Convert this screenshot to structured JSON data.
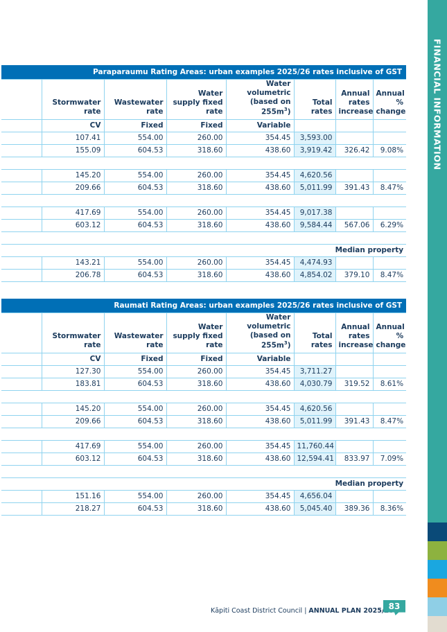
{
  "side_tab": {
    "label": "FINANCIAL INFORMATION"
  },
  "strip_colors": [
    "#0a4a78",
    "#8db23f",
    "#1aa7e0",
    "#f08c1e",
    "#8fcfe6",
    "#e2dcd0"
  ],
  "tables": [
    {
      "title": "Paraparaumu Rating Areas: urban examples 2025/26 rates inclusive of GST",
      "headers": {
        "stormwater": "Stormwater rate",
        "wastewater": "Wastewater rate",
        "water_fixed": "Water supply fixed rate",
        "water_vol_a": "Water volumetric",
        "water_vol_b": "(based on 255m",
        "water_vol_sup": "3",
        "water_vol_c": ")",
        "total": "Total rates",
        "annual_inc": "Annual rates increase",
        "annual_pct": "Annual % change"
      },
      "basis": {
        "stormwater": "CV",
        "wastewater": "Fixed",
        "water_fixed": "Fixed",
        "water_vol": "Variable"
      },
      "groups": [
        {
          "rows": [
            [
              "107.41",
              "554.00",
              "260.00",
              "354.45",
              "3,593.00",
              "",
              ""
            ],
            [
              "155.09",
              "604.53",
              "318.60",
              "438.60",
              "3,919.42",
              "326.42",
              "9.08%"
            ]
          ]
        },
        {
          "rows": [
            [
              "145.20",
              "554.00",
              "260.00",
              "354.45",
              "4,620.56",
              "",
              ""
            ],
            [
              "209.66",
              "604.53",
              "318.60",
              "438.60",
              "5,011.99",
              "391.43",
              "8.47%"
            ]
          ]
        },
        {
          "rows": [
            [
              "417.69",
              "554.00",
              "260.00",
              "354.45",
              "9,017.38",
              "",
              ""
            ],
            [
              "603.12",
              "604.53",
              "318.60",
              "438.60",
              "9,584.44",
              "567.06",
              "6.29%"
            ]
          ]
        }
      ],
      "median_label": "Median property",
      "median_rows": [
        [
          "143.21",
          "554.00",
          "260.00",
          "354.45",
          "4,474.93",
          "",
          ""
        ],
        [
          "206.78",
          "604.53",
          "318.60",
          "438.60",
          "4,854.02",
          "379.10",
          "8.47%"
        ]
      ]
    },
    {
      "title": "Raumati Rating Areas: urban examples 2025/26 rates inclusive of GST",
      "headers": {
        "stormwater": "Stormwater rate",
        "wastewater": "Wastewater rate",
        "water_fixed": "Water supply fixed rate",
        "water_vol_a": "Water volumetric",
        "water_vol_b": "(based on 255m",
        "water_vol_sup": "3",
        "water_vol_c": ")",
        "total": "Total rates",
        "annual_inc": "Annual rates increase",
        "annual_pct": "Annual % change"
      },
      "basis": {
        "stormwater": "CV",
        "wastewater": "Fixed",
        "water_fixed": "Fixed",
        "water_vol": "Variable"
      },
      "groups": [
        {
          "rows": [
            [
              "127.30",
              "554.00",
              "260.00",
              "354.45",
              "3,711.27",
              "",
              ""
            ],
            [
              "183.81",
              "604.53",
              "318.60",
              "438.60",
              "4,030.79",
              "319.52",
              "8.61%"
            ]
          ]
        },
        {
          "rows": [
            [
              "145.20",
              "554.00",
              "260.00",
              "354.45",
              "4,620.56",
              "",
              ""
            ],
            [
              "209.66",
              "604.53",
              "318.60",
              "438.60",
              "5,011.99",
              "391.43",
              "8.47%"
            ]
          ]
        },
        {
          "rows": [
            [
              "417.69",
              "554.00",
              "260.00",
              "354.45",
              "11,760.44",
              "",
              ""
            ],
            [
              "603.12",
              "604.53",
              "318.60",
              "438.60",
              "12,594.41",
              "833.97",
              "7.09%"
            ]
          ]
        }
      ],
      "median_label": "Median property",
      "median_rows": [
        [
          "151.16",
          "554.00",
          "260.00",
          "354.45",
          "4,656.04",
          "",
          ""
        ],
        [
          "218.27",
          "604.53",
          "318.60",
          "438.60",
          "5,045.40",
          "389.36",
          "8.36%"
        ]
      ]
    }
  ],
  "footer": {
    "council": "Kāpiti Coast District Council",
    "plan": "ANNUAL PLAN 2025/26",
    "page": "83"
  }
}
